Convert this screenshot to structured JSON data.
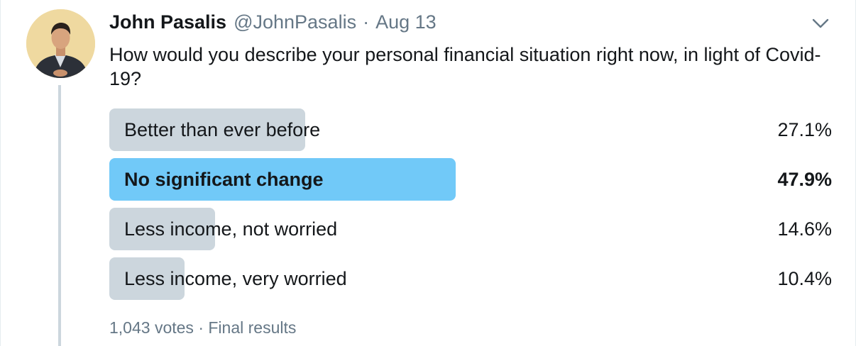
{
  "tweet": {
    "author_name": "John Pasalis",
    "author_handle": "@JohnPasalis",
    "separator": "·",
    "date": "Aug 13",
    "text": "How would you describe your personal financial situation right now, in light of Covid-19?",
    "menu_icon": "chevron-down-icon",
    "avatar_icon": "profile-photo"
  },
  "poll": {
    "options": [
      {
        "label": "Better than ever before",
        "percent_text": "27.1%",
        "percent": 27.1,
        "winner": false
      },
      {
        "label": "No significant change",
        "percent_text": "47.9%",
        "percent": 47.9,
        "winner": true
      },
      {
        "label": "Less income, not worried",
        "percent_text": "14.6%",
        "percent": 14.6,
        "winner": false
      },
      {
        "label": "Less income, very worried",
        "percent_text": "10.4%",
        "percent": 10.4,
        "winner": false
      }
    ],
    "votes": "1,043 votes",
    "separator": "·",
    "status": "Final results"
  },
  "colors": {
    "bar": "#ccd6dd",
    "winner_bar": "#71c9f8",
    "secondary_text": "#657786",
    "primary_text": "#14171a"
  }
}
